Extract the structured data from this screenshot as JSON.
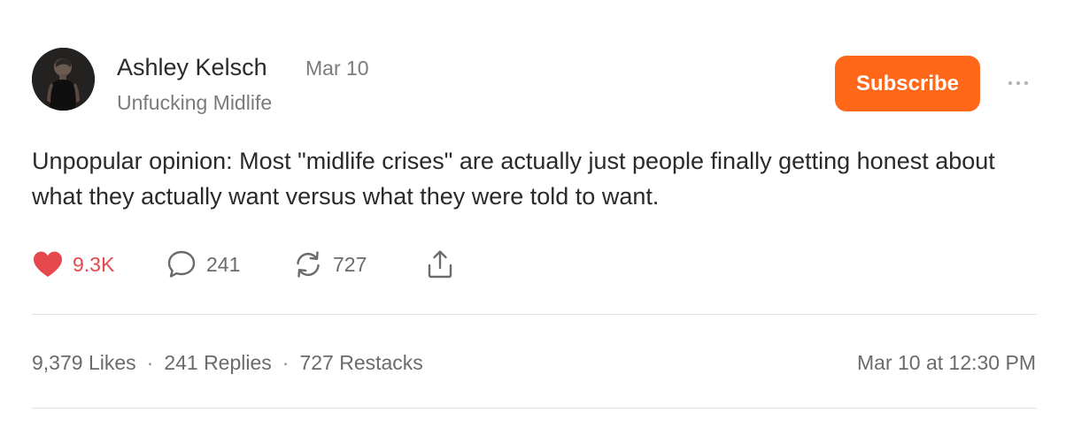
{
  "author": {
    "name": "Ashley Kelsch",
    "publication": "Unfucking Midlife",
    "avatar_icon": "profile-photo"
  },
  "post": {
    "date": "Mar 10",
    "body": "Unpopular opinion: Most \"midlife crises\" are actually just people finally getting honest about what they actually want versus what they were told to want.",
    "timestamp": "Mar 10 at 12:30 PM"
  },
  "subscribe": {
    "label": "Subscribe",
    "color": "#ff6719"
  },
  "more_menu_icon": "ellipsis-icon",
  "actions": {
    "likes": {
      "count": "9.3K",
      "icon": "heart-icon",
      "color": "#e5484d"
    },
    "replies": {
      "count": "241",
      "icon": "comment-bubble-icon"
    },
    "restacks": {
      "count": "727",
      "icon": "restack-arrows-icon"
    },
    "share": {
      "icon": "share-upload-icon"
    }
  },
  "stats": {
    "likes": "9,379 Likes",
    "replies": "241 Replies",
    "restacks": "727 Restacks",
    "separator": "·"
  }
}
